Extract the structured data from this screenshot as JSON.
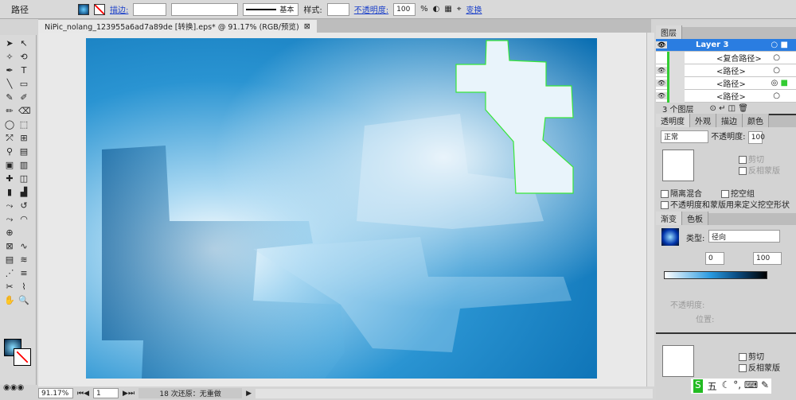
{
  "control_bar": {
    "selection": "路径",
    "stroke_label": "描边:",
    "weight_value": "",
    "profile": "基本",
    "style_label": "样式:",
    "opacity_label": "不透明度:",
    "opacity_value": "100",
    "percent": "%",
    "transform": "变换"
  },
  "document": {
    "tab_title": "NiPic_nolang_123955a6ad7a89de  [转换].eps* @ 91.17% (RGB/预览)"
  },
  "status_bar": {
    "zoom": "91.17%",
    "artboard": "1",
    "undo_status": "18 次还原：无重做"
  },
  "layers_panel": {
    "title": "图层",
    "rows": [
      {
        "name": "Layer 3",
        "visible": true
      },
      {
        "name": "<复合路径>",
        "visible": false
      },
      {
        "name": "<路径>",
        "visible": true
      },
      {
        "name": "<路径>",
        "visible": true,
        "selected": true
      },
      {
        "name": "<路径>",
        "visible": true
      }
    ],
    "count": "3 个图层"
  },
  "transparency_panel": {
    "tabs": [
      "透明度",
      "外观",
      "描边",
      "颜色"
    ],
    "mode": "正常",
    "opacity_label": "不透明度:",
    "opacity_value": "100",
    "clip": "剪切",
    "invert_mask": "反相蒙版",
    "isolate": "隔离混合",
    "knockout": "挖空组",
    "opacity_mask_shape": "不透明度和蒙版用来定义挖空形状"
  },
  "gradient_panel": {
    "tabs": [
      "渐变",
      "色板"
    ],
    "type_label": "类型:",
    "type_value": "径向",
    "angle": "0",
    "aspect": "100",
    "stop_opacity_label": "不透明度:",
    "location_label": "位置:"
  },
  "lower_panel": {
    "clip": "剪切",
    "invert_mask": "反相蒙版"
  },
  "ime_bar": {
    "mode": "五"
  },
  "colors": {
    "accent": "#1e6fc8",
    "selection": "#39e639",
    "artboard_blue": "#1683c7"
  }
}
